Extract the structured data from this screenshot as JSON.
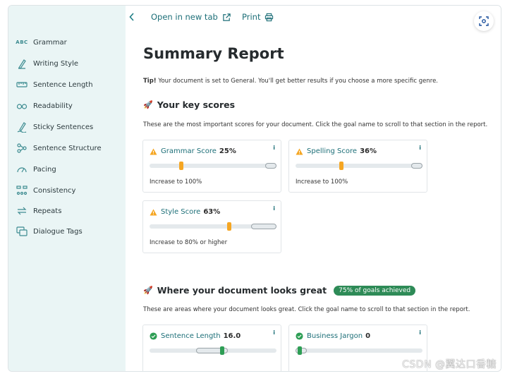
{
  "sidebar": {
    "items": [
      {
        "label": "Grammar",
        "icon": "abc-icon"
      },
      {
        "label": "Writing Style",
        "icon": "pen-icon"
      },
      {
        "label": "Sentence Length",
        "icon": "ruler-icon"
      },
      {
        "label": "Readability",
        "icon": "glasses-icon"
      },
      {
        "label": "Sticky Sentences",
        "icon": "sticky-pen-icon"
      },
      {
        "label": "Sentence Structure",
        "icon": "structure-icon"
      },
      {
        "label": "Pacing",
        "icon": "gauge-icon"
      },
      {
        "label": "Consistency",
        "icon": "consistency-icon"
      },
      {
        "label": "Repeats",
        "icon": "repeat-icon"
      },
      {
        "label": "Dialogue Tags",
        "icon": "dialogue-icon"
      }
    ],
    "abc_text": "ABC"
  },
  "topbar": {
    "open_new_tab": "Open in new tab",
    "print": "Print"
  },
  "report": {
    "title": "Summary Report",
    "tip_label": "Tip!",
    "tip_text": " Your document is set to General. You'll get better results if you choose a more specific genre."
  },
  "key_scores": {
    "title": "Your key scores",
    "desc": "These are the most important scores for your document. Click the goal name to scroll to that section in the report.",
    "cards": [
      {
        "name": "Grammar Score",
        "score": "25%",
        "note": "Increase to 100%",
        "value": 25,
        "target_min": 100,
        "target_max": 100
      },
      {
        "name": "Spelling Score",
        "score": "36%",
        "note": "Increase to 100%",
        "value": 36,
        "target_min": 100,
        "target_max": 100
      },
      {
        "name": "Style Score",
        "score": "63%",
        "note": "Increase to 80% or higher",
        "value": 63,
        "target_min": 80,
        "target_max": 100
      }
    ]
  },
  "great": {
    "title": "Where your document looks great",
    "badge": "75% of goals achieved",
    "desc": "These are areas where your document looks great. Click the goal name to scroll to that section in the report.",
    "cards": [
      {
        "name": "Sentence Length",
        "score": "16.0",
        "value": 16.0
      },
      {
        "name": "Business Jargon",
        "score": "0",
        "value": 0
      }
    ]
  },
  "info_label": "i",
  "watermark": "CSDN @翼达口香糖",
  "colors": {
    "accent": "#1d6f78",
    "warning": "#f5a623",
    "success": "#2e9e55",
    "sidebar_bg": "#eaf5f5",
    "badge_bg": "#2e8b57"
  }
}
